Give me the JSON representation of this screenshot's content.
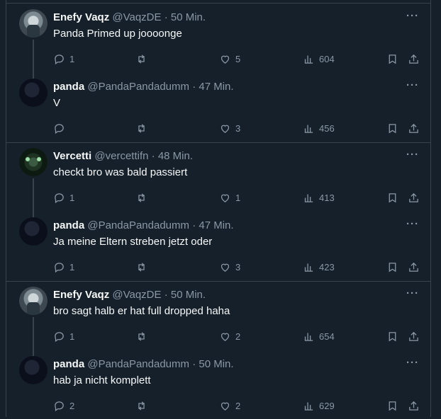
{
  "threads": [
    {
      "tweets": [
        {
          "name": "Enefy Vaqz",
          "handle": "@VaqzDE",
          "time": "50 Min.",
          "text": "Panda Primed up joooonge",
          "replies": "1",
          "retweets": "",
          "likes": "5",
          "views": "604",
          "avatar": "enefy-avatar"
        },
        {
          "name": "panda",
          "handle": "@PandaPandadumm",
          "time": "47 Min.",
          "text": "V",
          "replies": "",
          "retweets": "",
          "likes": "3",
          "views": "456",
          "avatar": "panda-avatar"
        }
      ]
    },
    {
      "tweets": [
        {
          "name": "Vercetti",
          "handle": "@vercettifn",
          "time": "48 Min.",
          "text": "checkt bro was bald passiert",
          "replies": "1",
          "retweets": "",
          "likes": "1",
          "views": "413",
          "avatar": "vercetti-avatar"
        },
        {
          "name": "panda",
          "handle": "@PandaPandadumm",
          "time": "47 Min.",
          "text": "Ja meine Eltern streben jetzt oder",
          "replies": "1",
          "retweets": "",
          "likes": "3",
          "views": "423",
          "avatar": "panda-avatar"
        }
      ]
    },
    {
      "tweets": [
        {
          "name": "Enefy Vaqz",
          "handle": "@VaqzDE",
          "time": "50 Min.",
          "text": "bro sagt halb er hat full dropped haha",
          "replies": "1",
          "retweets": "",
          "likes": "2",
          "views": "654",
          "avatar": "enefy-avatar"
        },
        {
          "name": "panda",
          "handle": "@PandaPandadumm",
          "time": "50 Min.",
          "text": "hab ja nicht komplett",
          "replies": "2",
          "retweets": "",
          "likes": "2",
          "views": "629",
          "avatar": "panda-avatar"
        }
      ]
    }
  ],
  "ui": {
    "separator": "·",
    "more": "···"
  }
}
